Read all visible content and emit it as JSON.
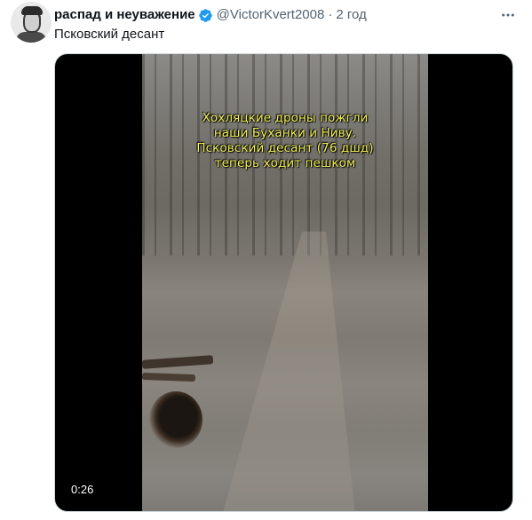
{
  "tweet": {
    "author": {
      "display_name": "распад и неуважение",
      "handle": "@VictorKvert2008",
      "separator": "·",
      "time": "2 год",
      "verified": true
    },
    "text": "Псковский десант",
    "media": {
      "overlay_caption": "Хохляцкие дроны пожгли\nнаши Буханки и Ниву.\nПсковский десант (76 дшд)\nтеперь ходит пешком",
      "duration": "0:26"
    }
  },
  "icons": {
    "verified": "verified-badge-icon",
    "more": "more-options-icon"
  },
  "colors": {
    "verified": "#1d9bf0",
    "secondary_text": "#536471",
    "primary_text": "#0f1419",
    "overlay_text": "#f2f25a"
  }
}
